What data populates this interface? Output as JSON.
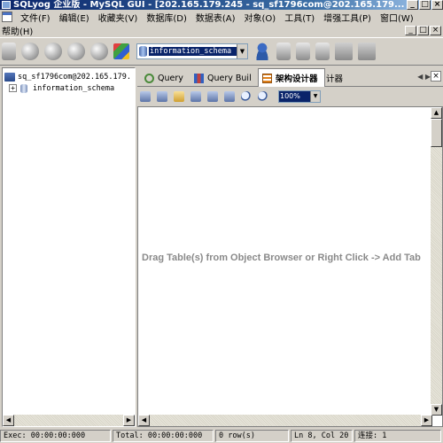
{
  "window": {
    "title": "SQLyog 企业版 - MySQL GUI - [202.165.179.245 - sq_sf1796com@202.165.179...",
    "controls": [
      "_",
      "□",
      "×"
    ]
  },
  "menu": {
    "items": [
      "文件(F)",
      "编辑(E)",
      "收藏夹(V)",
      "数据库(D)",
      "数据表(A)",
      "对象(O)",
      "工具(T)",
      "增强工具(P)",
      "窗口(W)"
    ],
    "help": "帮助(H)",
    "mdi_controls": [
      "_",
      "□",
      "×"
    ]
  },
  "toolbar": {
    "database_selector": "information_schema",
    "icons": [
      "connect-icon",
      "new-connection-icon",
      "disconnect-icon",
      "refresh-icon",
      "execute-icon",
      "color-scheme-icon",
      "user-manager-icon",
      "backup-icon",
      "restore-icon",
      "import-icon",
      "table-icon",
      "schema-icon"
    ]
  },
  "object_browser": {
    "connection": "sq_sf1796com@202.165.179.",
    "databases": [
      "information_schema"
    ],
    "expand_symbol": "+"
  },
  "tabs": {
    "items": [
      {
        "label": "Query",
        "icon": "query-icon"
      },
      {
        "label": "Query Buil",
        "icon": "query-builder-icon"
      },
      {
        "label": "架构设计器",
        "icon": "schema-designer-icon"
      }
    ],
    "overflow_fragment": "计器",
    "close": "×"
  },
  "designer": {
    "zoom": "100%",
    "hint": "Drag Table(s) from Object Browser or Right Click -> Add Tab"
  },
  "statusbar": {
    "exec": "Exec: 00:00:00:000",
    "total": "Total: 00:00:00:000",
    "rows": "0 row(s)",
    "position": "Ln 8, Col 20",
    "connection": "连接: 1"
  }
}
